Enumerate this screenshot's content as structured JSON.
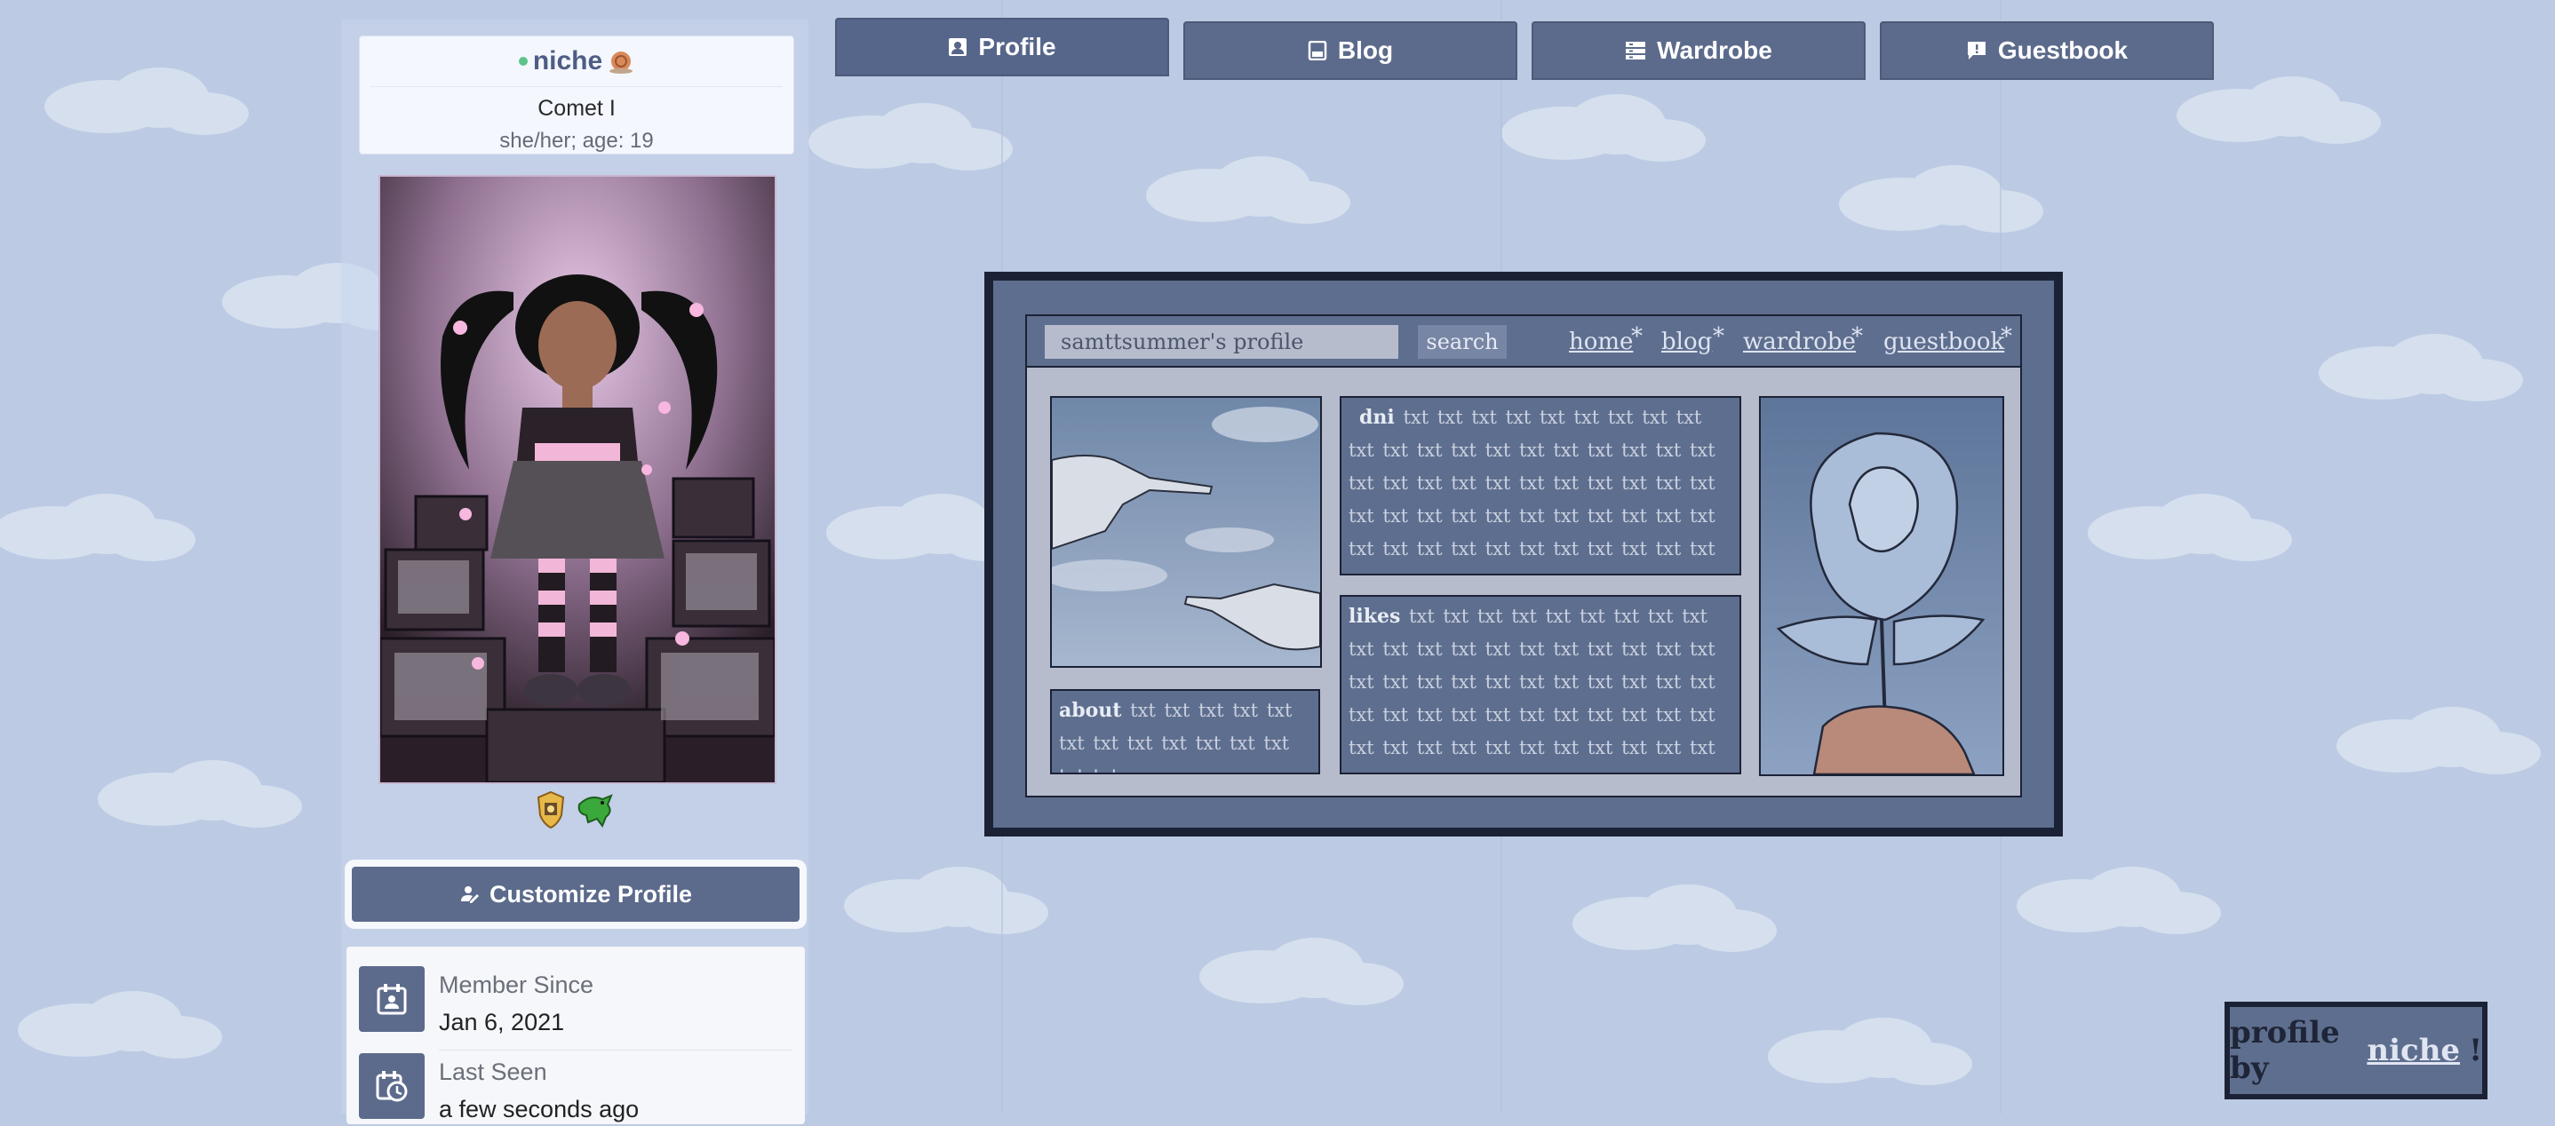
{
  "profile": {
    "username": "niche",
    "display_name": "Comet I",
    "pronouns_age": "she/her; age: 19",
    "status_color": "#5cc48a"
  },
  "tabs": [
    {
      "label": "Profile",
      "icon": "user-card-icon",
      "active": true
    },
    {
      "label": "Blog",
      "icon": "blog-icon",
      "active": false
    },
    {
      "label": "Wardrobe",
      "icon": "wardrobe-icon",
      "active": false
    },
    {
      "label": "Guestbook",
      "icon": "guestbook-icon",
      "active": false
    }
  ],
  "sidebar": {
    "customize_label": "Customize Profile",
    "badges": [
      "gold-shield-badge",
      "green-dragon-badge"
    ],
    "stats": [
      {
        "label": "Member Since",
        "value": "Jan 6, 2021",
        "icon": "calendar-user-icon"
      },
      {
        "label": "Last Seen",
        "value": "a few seconds ago",
        "icon": "calendar-clock-icon"
      }
    ]
  },
  "layout": {
    "search_value": "samttsummer's profile",
    "search_button": "search",
    "nav_links": [
      "home",
      "blog",
      "wardrobe",
      "guestbook"
    ],
    "nav_suffix": "*",
    "about_title": "about",
    "about_text": "txt txt txt txt txt txt txt txt txt txt txt txt txt txt",
    "dni_title": "dni",
    "dni_text": "txt txt txt txt txt txt txt txt txt txt txt txt txt txt txt txt txt txt txt txt txt txt txt txt txt txt txt txt txt txt txt txt txt txt txt txt txt txt txt txt txt txt txt txt txt txt txt txt txt txt txt txt txt txt txt txt txt txt",
    "likes_title": "likes",
    "likes_text": "txt txt txt txt txt txt txt txt txt txt txt txt txt txt txt txt txt txt txt txt txt txt txt txt txt txt txt txt txt txt txt txt txt txt txt txt txt txt txt txt txt txt txt txt txt txt txt txt txt txt txt txt txt txt txt txt txt txt"
  },
  "credit": {
    "prefix": "profile by",
    "link": "niche",
    "suffix": "!"
  },
  "colors": {
    "accent": "#5c6b8c",
    "background": "#bccbe3",
    "layout_dark": "#1c2236"
  }
}
